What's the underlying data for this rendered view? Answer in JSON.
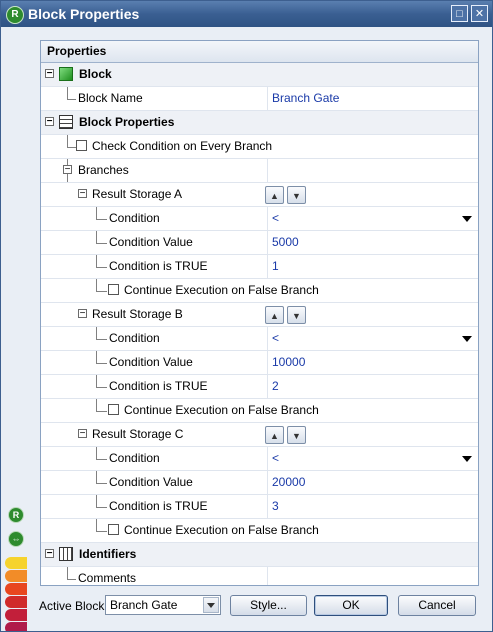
{
  "window": {
    "title": "Block Properties",
    "maximize_icon": "maximize-icon",
    "close_icon": "close-icon"
  },
  "panel": {
    "header": "Properties",
    "sections": {
      "block": {
        "label": "Block",
        "block_name_label": "Block Name",
        "block_name_value": "Branch Gate"
      },
      "block_properties": {
        "label": "Block Properties",
        "check_condition_label": "Check Condition on Every Branch",
        "branches_label": "Branches"
      },
      "identifiers": {
        "label": "Identifiers",
        "comments_label": "Comments",
        "comments_value": ""
      }
    },
    "branches": [
      {
        "title": "Result Storage A",
        "condition_label": "Condition",
        "condition_value": "<",
        "condition_value_label": "Condition Value",
        "condition_value_value": "5000",
        "is_true_label": "Condition is TRUE",
        "is_true_value": "1",
        "continue_label": "Continue Execution on False Branch"
      },
      {
        "title": "Result Storage B",
        "condition_label": "Condition",
        "condition_value": "<",
        "condition_value_label": "Condition Value",
        "condition_value_value": "10000",
        "is_true_label": "Condition is TRUE",
        "is_true_value": "2",
        "continue_label": "Continue Execution on False Branch"
      },
      {
        "title": "Result Storage C",
        "condition_label": "Condition",
        "condition_value": "<",
        "condition_value_label": "Condition Value",
        "condition_value_value": "20000",
        "is_true_label": "Condition is TRUE",
        "is_true_value": "3",
        "continue_label": "Continue Execution on False Branch"
      }
    ]
  },
  "footer": {
    "active_block_label": "Active Block",
    "active_block_value": "Branch Gate",
    "style_button": "Style...",
    "ok_button": "OK",
    "cancel_button": "Cancel"
  },
  "colors": {
    "value_text": "#1a3aa8",
    "title_bar": "#3a5f92",
    "accent_green": "#2e8b2e"
  }
}
